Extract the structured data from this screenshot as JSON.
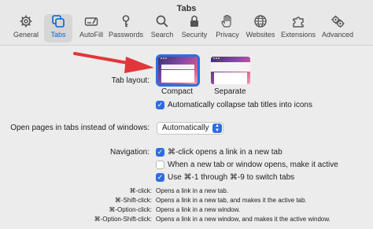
{
  "window": {
    "title": "Tabs"
  },
  "toolbar": {
    "items": [
      {
        "label": "General",
        "icon": "gear-icon"
      },
      {
        "label": "Tabs",
        "icon": "tabs-icon"
      },
      {
        "label": "AutoFill",
        "icon": "autofill-icon"
      },
      {
        "label": "Passwords",
        "icon": "key-icon"
      },
      {
        "label": "Search",
        "icon": "search-icon"
      },
      {
        "label": "Security",
        "icon": "lock-icon"
      },
      {
        "label": "Privacy",
        "icon": "hand-icon"
      },
      {
        "label": "Websites",
        "icon": "globe-icon"
      },
      {
        "label": "Extensions",
        "icon": "puzzle-icon"
      },
      {
        "label": "Advanced",
        "icon": "gears-icon"
      }
    ],
    "selected": "Tabs"
  },
  "tab_layout": {
    "label": "Tab layout:",
    "options": [
      {
        "label": "Compact",
        "selected": true
      },
      {
        "label": "Separate",
        "selected": false
      }
    ],
    "collapse_label": "Automatically collapse tab titles into icons",
    "collapse_checked": true
  },
  "open_pages": {
    "label": "Open pages in tabs instead of windows:",
    "value": "Automatically"
  },
  "navigation": {
    "label": "Navigation:",
    "options": [
      {
        "label": "⌘-click opens a link in a new tab",
        "checked": true
      },
      {
        "label": "When a new tab or window opens, make it active",
        "checked": false
      },
      {
        "label": "Use ⌘-1 through ⌘-9 to switch tabs",
        "checked": true
      }
    ]
  },
  "shortcuts": [
    {
      "key": "⌘-click:",
      "desc": "Opens a link in a new tab."
    },
    {
      "key": "⌘-Shift-click:",
      "desc": "Opens a link in a new tab, and makes it the active tab."
    },
    {
      "key": "⌘-Option-click:",
      "desc": "Opens a link in a new window."
    },
    {
      "key": "⌘-Option-Shift-click:",
      "desc": "Opens a link in a new window, and makes it the active window."
    }
  ],
  "colors": {
    "accent": "#2f6de1",
    "annotation_arrow": "#e2373a"
  }
}
